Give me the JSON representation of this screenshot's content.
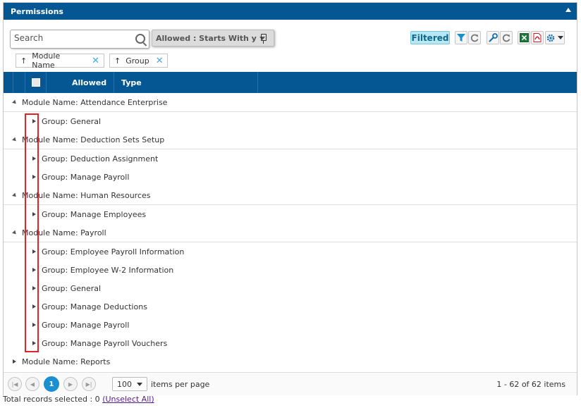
{
  "panel": {
    "title": "Permissions"
  },
  "toolbar": {
    "search_placeholder": "Search",
    "filter_chip_label": "Allowed : Starts With y",
    "filtered_label": "Filtered",
    "sort_chips": [
      {
        "label": "Module Name"
      },
      {
        "label": "Group"
      }
    ]
  },
  "icons": {
    "filter": "filter-icon",
    "refresh": "refresh-icon",
    "wrench": "wrench-icon",
    "excel": "excel-icon",
    "pdf": "pdf-icon",
    "gear": "gear-icon"
  },
  "colors": {
    "header_blue": "#045792",
    "highlight_red": "#e3222a",
    "pager_active": "#1b8fd0"
  },
  "grid": {
    "columns": [
      "Allowed",
      "Type"
    ],
    "rows": [
      {
        "kind": "module",
        "text": "Module Name: Attendance Enterprise",
        "expanded": true
      },
      {
        "kind": "group",
        "text": "Group: General"
      },
      {
        "kind": "module",
        "text": "Module Name: Deduction Sets Setup",
        "expanded": true
      },
      {
        "kind": "group",
        "text": "Group: Deduction Assignment"
      },
      {
        "kind": "group",
        "text": "Group: Manage Payroll"
      },
      {
        "kind": "module",
        "text": "Module Name: Human Resources",
        "expanded": true
      },
      {
        "kind": "group",
        "text": "Group: Manage Employees"
      },
      {
        "kind": "module",
        "text": "Module Name: Payroll",
        "expanded": true
      },
      {
        "kind": "group",
        "text": "Group: Employee Payroll Information"
      },
      {
        "kind": "group",
        "text": "Group: Employee W-2 Information"
      },
      {
        "kind": "group",
        "text": "Group: General"
      },
      {
        "kind": "group",
        "text": "Group: Manage Deductions"
      },
      {
        "kind": "group",
        "text": "Group: Manage Payroll"
      },
      {
        "kind": "group",
        "text": "Group: Manage Payroll Vouchers"
      },
      {
        "kind": "module",
        "text": "Module Name: Reports",
        "expanded": false
      }
    ]
  },
  "pager": {
    "current_page": "1",
    "page_size": "100",
    "items_per_page_label": "items per page",
    "info": "1 - 62 of 62 items"
  },
  "footer": {
    "total_selected": "Total records selected : 0",
    "unselect_all": "(Unselect All)"
  }
}
